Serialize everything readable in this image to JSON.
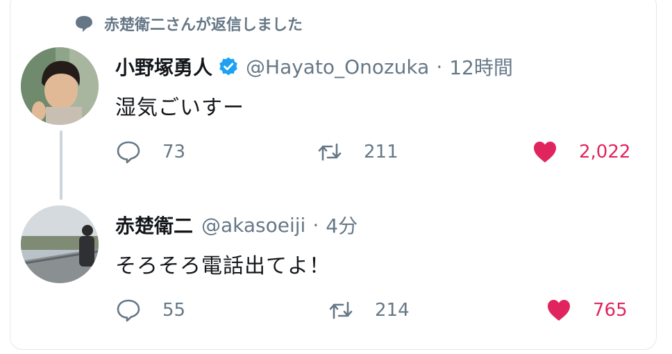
{
  "reply_context": {
    "text": "赤楚衛二さんが返信しました"
  },
  "tweets": [
    {
      "display_name": "小野塚勇人",
      "handle": "@Hayato_Onozuka",
      "separator": "·",
      "time": "12時間",
      "text": "湿気ごいすー",
      "reply_count": "73",
      "retweet_count": "211",
      "like_count": "2,022"
    },
    {
      "display_name": "赤楚衛二",
      "handle": "@akasoeiji",
      "separator": "·",
      "time": "4分",
      "text": "そろそろ電話出てよ！",
      "reply_count": "55",
      "retweet_count": "214",
      "like_count": "765"
    }
  ],
  "colors": {
    "like_red": "#e0245e",
    "verified_blue": "#1da1f2",
    "muted_gray": "#657786"
  },
  "icons": [
    "comment-bubble-icon",
    "verified-icon",
    "reply-icon",
    "retweet-icon",
    "heart-icon"
  ]
}
